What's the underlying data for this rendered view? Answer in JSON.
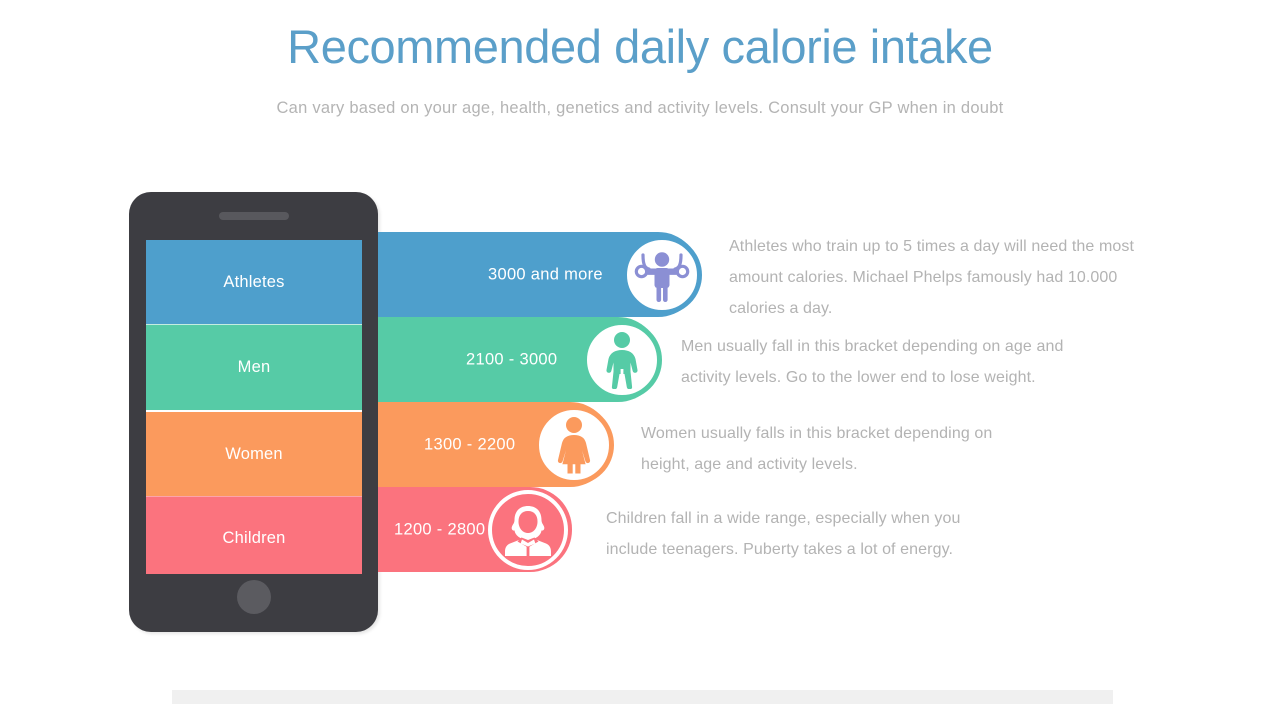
{
  "header": {
    "title": "Recommended daily calorie intake",
    "subtitle": "Can vary based on your age, health, genetics and activity levels. Consult your GP when in doubt",
    "title_color": "#5b9fc9",
    "subtitle_color": "#b4b4b4"
  },
  "phone": {
    "frame_color": "#3d3d42",
    "speaker_color": "#58585d",
    "home_button_color": "#5b5b60",
    "screen_labels": [
      "Athletes",
      "Men",
      "Women",
      "Children"
    ]
  },
  "chart_data": {
    "type": "bar",
    "title": "Recommended daily calorie intake",
    "subtitle": "Can vary based on your age, health, genetics and activity levels. Consult your GP when in doubt",
    "xlabel": "",
    "ylabel": "",
    "categories": [
      "Athletes",
      "Men",
      "Women",
      "Children"
    ],
    "value_labels": [
      "3000 and more",
      "2100 - 3000",
      "1300 - 2200",
      "1200 - 2800"
    ],
    "values": [
      3000,
      3000,
      2200,
      2800
    ],
    "ranges": [
      [
        3000,
        null
      ],
      [
        2100,
        3000
      ],
      [
        1300,
        2200
      ],
      [
        1200,
        2800
      ]
    ],
    "colors": [
      "#4e9fcc",
      "#56cba6",
      "#fb9a5d",
      "#fb737e"
    ],
    "grid": false,
    "legend": "none"
  },
  "rows": [
    {
      "category": "Athletes",
      "value_label": "3000 and more",
      "color": "#4e9fcc",
      "icon": "gymnast-rings-icon",
      "icon_color": "#8b8fd4",
      "description": "Athletes who train up to 5 times a day will need the most amount calories. Michael Phelps  famously had 10.000 calories a day."
    },
    {
      "category": "Men",
      "value_label": "2100 - 3000",
      "color": "#56cba6",
      "icon": "man-icon",
      "icon_color": "#56cba6",
      "description": "Men usually fall in this bracket depending on age and activity levels. Go to the lower end to lose weight."
    },
    {
      "category": "Women",
      "value_label": "1300 - 2200",
      "color": "#fb9a5d",
      "icon": "woman-icon",
      "icon_color": "#fb9a5d",
      "description": "Women usually falls in this bracket depending on height, age and activity levels."
    },
    {
      "category": "Children",
      "value_label": "1200 - 2800",
      "color": "#fb737e",
      "icon": "schoolgirl-icon",
      "icon_color": "#ffffff",
      "description": "Children fall in a wide range, especially when you include teenagers. Puberty takes a lot of energy."
    }
  ],
  "bottom_strip_color": "#f0f0f0"
}
